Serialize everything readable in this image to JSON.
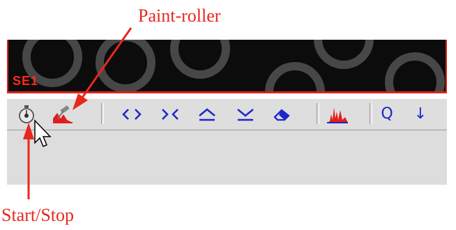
{
  "annotations": {
    "paint_roller": "Paint-roller",
    "start_stop": "Start/Stop",
    "color": "#e8281e"
  },
  "image_panel": {
    "label": "SE1",
    "border_color": "#d8231a"
  },
  "toolbar": {
    "icons": [
      "stopwatch-icon",
      "paint-roller-icon",
      "expand-horizontal-icon",
      "contract-horizontal-icon",
      "arrow-up-icon",
      "arrow-down-icon",
      "eraser-icon",
      "histogram-icon",
      "zoom-icon",
      "down-arrow-icon"
    ],
    "glyphs": {
      "expand": "<>",
      "contract": "><",
      "up": "⏶",
      "down": "⏷",
      "zoom": "Q",
      "down_arrow": "↓"
    }
  }
}
